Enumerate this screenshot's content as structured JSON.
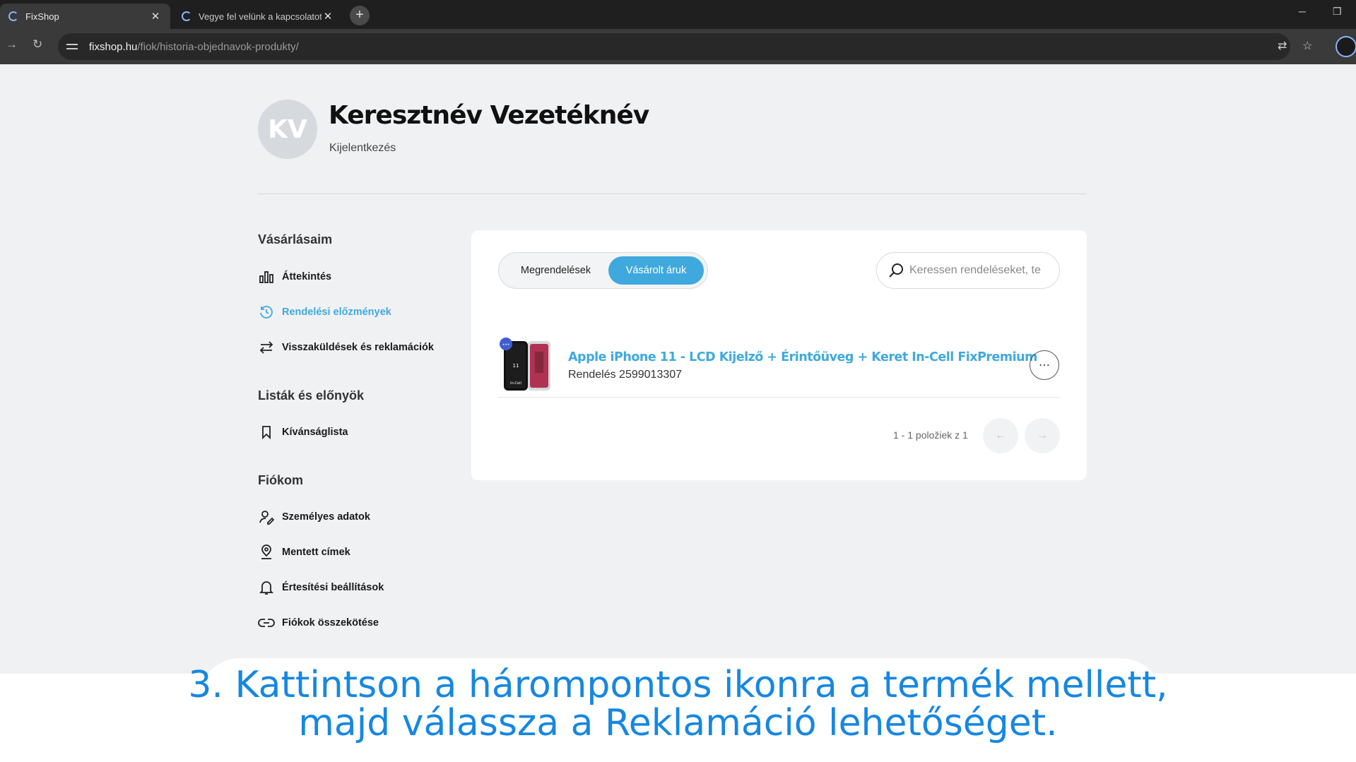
{
  "browser": {
    "tabs": [
      {
        "title": "FixShop"
      },
      {
        "title": "Vegye fel velünk a kapcsolatot |"
      }
    ],
    "address": {
      "host": "fixshop.hu",
      "path": "/fiok/historia-objednavok-produkty/"
    }
  },
  "profile": {
    "initials": "KV",
    "name": "Keresztnév Vezetéknév",
    "logout": "Kijelentkezés"
  },
  "sidebar": {
    "sections": [
      {
        "heading": "Vásárlásaim",
        "items": [
          {
            "label": "Áttekintés",
            "icon": "chart-icon"
          },
          {
            "label": "Rendelési előzmények",
            "icon": "history-icon",
            "active": true
          },
          {
            "label": "Visszaküldések és reklamációk",
            "icon": "swap-icon"
          }
        ]
      },
      {
        "heading": "Listák és előnyök",
        "items": [
          {
            "label": "Kívánságlista",
            "icon": "bookmark-icon"
          }
        ]
      },
      {
        "heading": "Fiókom",
        "items": [
          {
            "label": "Személyes adatok",
            "icon": "user-edit-icon"
          },
          {
            "label": "Mentett címek",
            "icon": "location-icon"
          },
          {
            "label": "Értesítési beállítások",
            "icon": "bell-icon"
          },
          {
            "label": "Fiókok összekötése",
            "icon": "link-icon"
          }
        ]
      }
    ]
  },
  "main": {
    "tabs": [
      {
        "label": "Megrendelések"
      },
      {
        "label": "Vásárolt áruk",
        "active": true
      }
    ],
    "search_placeholder": "Keressen rendeléseket, te",
    "products": [
      {
        "title": "Apple iPhone 11 - LCD Kijelző + Érintőüveg + Keret In-Cell FixPremium",
        "order": "Rendelés 2599013307",
        "thumb_label_top": "11",
        "thumb_label_bottom": "In-Cell"
      }
    ],
    "pagination": {
      "text": "1 - 1 položiek z 1",
      "prev": "←",
      "next": "→"
    }
  },
  "caption": {
    "line1": "3. Kattintson a hárompontos ikonra a termék mellett,",
    "line2": "majd válassza a Reklamáció lehetőséget."
  },
  "colors": {
    "accent": "#3fa9de",
    "caption": "#1787e0"
  }
}
